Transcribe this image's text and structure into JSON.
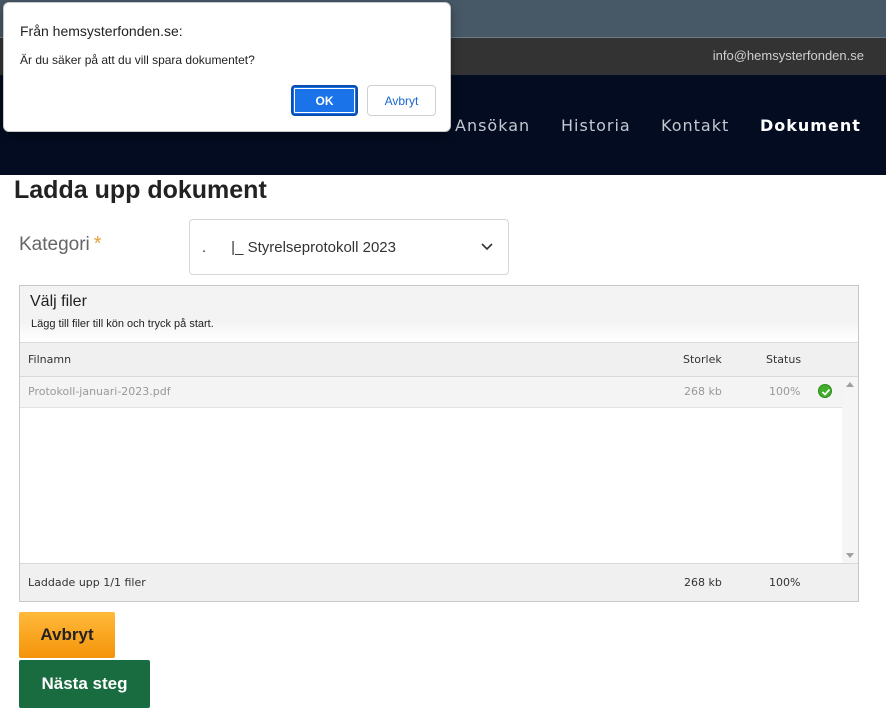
{
  "header": {
    "email": "info@hemsysterfonden.se",
    "nav": [
      {
        "label": "Ansökan",
        "active": false
      },
      {
        "label": "Historia",
        "active": false
      },
      {
        "label": "Kontakt",
        "active": false
      },
      {
        "label": "Dokument",
        "active": true
      }
    ]
  },
  "main": {
    "title": "Ladda upp dokument",
    "category_label": "Kategori",
    "required_marker": "*",
    "category_value": ".      |_ Styrelseprotokoll 2023"
  },
  "uploader": {
    "title": "Välj filer",
    "subtitle": "Lägg till filer till kön och tryck på start.",
    "columns": {
      "name": "Filnamn",
      "size": "Storlek",
      "status": "Status"
    },
    "files": [
      {
        "name": "Protokoll-januari-2023.pdf",
        "size": "268 kb",
        "status": "100%"
      }
    ],
    "footer": {
      "summary": "Laddade upp 1/1 filer",
      "size": "268 kb",
      "status": "100%"
    }
  },
  "buttons": {
    "cancel": "Avbryt",
    "next": "Nästa steg"
  },
  "dialog": {
    "title": "Från hemsysterfonden.se:",
    "message": "Är du säker på att du vill spara dokumentet?",
    "ok": "OK",
    "cancel": "Avbryt"
  },
  "colors": {
    "nav_bg": "#030c21",
    "cancel_button": "#f4940a",
    "next_button": "#196b40",
    "dialog_ok": "#1a73e8",
    "status_ok": "#3fae2a"
  },
  "icons": [
    "chevron-down-icon",
    "check-circle-icon",
    "scroll-up-icon",
    "scroll-down-icon"
  ]
}
